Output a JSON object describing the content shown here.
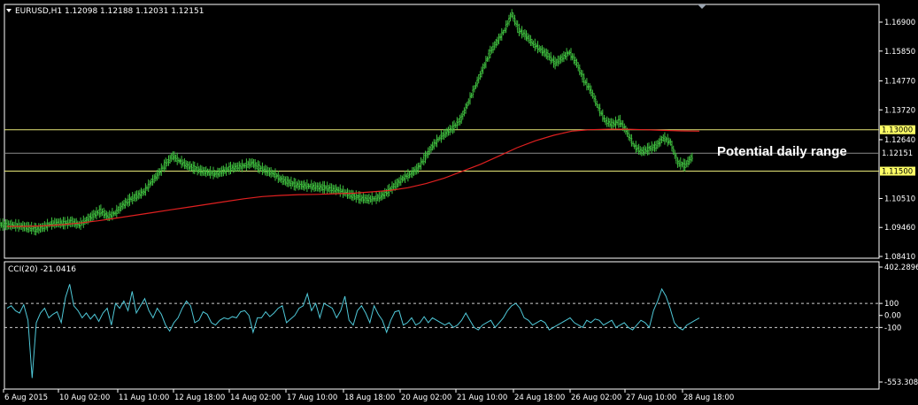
{
  "chart_header": {
    "symbol_line": "EURUSD,H1  1.12098 1.12188 1.12031 1.12151"
  },
  "indicator_header": {
    "text": "CCI(20) -21.0416"
  },
  "annotation": {
    "text": "Potential daily range"
  },
  "colors": {
    "background": "#000000",
    "candles": "#3fbf3f",
    "moving_average": "#e02020",
    "hline": "#e8e878",
    "current_price_line": "#8a8a8a",
    "cci_line": "#4fc8d8",
    "axis": "#ffffff",
    "tag_bg": "#ffff66"
  },
  "chart_data": [
    {
      "type": "line",
      "title": "EURUSD,H1",
      "ylim": [
        1.0841,
        1.174
      ],
      "price_axis_ticks": [
        "1.16900",
        "1.15850",
        "1.14770",
        "1.13720",
        "1.12640",
        "1.10510",
        "1.09460",
        "1.08410"
      ],
      "price_tags": [
        {
          "label": "1.13000",
          "value": 1.13,
          "style": "yellow"
        },
        {
          "label": "1.12151",
          "value": 1.12151,
          "style": "gray"
        },
        {
          "label": "1.11500",
          "value": 1.115,
          "style": "yellow"
        }
      ],
      "horizontal_lines": [
        1.13,
        1.115
      ],
      "current_price": 1.12151,
      "series": [
        {
          "kind": "price",
          "values": [
            1.0955,
            1.0953,
            1.095,
            1.0945,
            1.0938,
            1.0946,
            1.0958,
            1.0962,
            1.096,
            1.0966,
            1.0955,
            1.0972,
            1.099,
            1.1005,
            1.0985,
            1.0998,
            1.1025,
            1.1045,
            1.106,
            1.1075,
            1.111,
            1.114,
            1.1175,
            1.1205,
            1.1185,
            1.117,
            1.116,
            1.115,
            1.1145,
            1.114,
            1.115,
            1.116,
            1.1165,
            1.117,
            1.118,
            1.1162,
            1.115,
            1.114,
            1.112,
            1.111,
            1.11,
            1.1098,
            1.1095,
            1.1092,
            1.109,
            1.1085,
            1.108,
            1.107,
            1.106,
            1.1052,
            1.1048,
            1.105,
            1.106,
            1.108,
            1.1102,
            1.1125,
            1.114,
            1.116,
            1.12,
            1.124,
            1.127,
            1.129,
            1.131,
            1.134,
            1.14,
            1.146,
            1.152,
            1.158,
            1.162,
            1.166,
            1.172,
            1.166,
            1.164,
            1.161,
            1.159,
            1.157,
            1.154,
            1.156,
            1.158,
            1.154,
            1.148,
            1.144,
            1.138,
            1.133,
            1.132,
            1.133,
            1.129,
            1.124,
            1.122,
            1.123,
            1.124,
            1.127,
            1.1255,
            1.118,
            1.117,
            1.12,
            1.1215
          ]
        },
        {
          "kind": "moving_average",
          "values": [
            1.095,
            1.095,
            1.0952,
            1.0956,
            1.0962,
            1.097,
            1.098,
            1.099,
            1.1,
            1.101,
            1.102,
            1.103,
            1.104,
            1.105,
            1.1058,
            1.1062,
            1.1065,
            1.1066,
            1.1068,
            1.107,
            1.1075,
            1.108,
            1.109,
            1.1105,
            1.1125,
            1.115,
            1.1175,
            1.1205,
            1.1235,
            1.126,
            1.128,
            1.1295,
            1.13,
            1.1302,
            1.1302,
            1.13,
            1.1298,
            1.1296,
            1.1295
          ]
        }
      ]
    },
    {
      "type": "line",
      "title": "CCI(20)",
      "ylim": [
        -553.3084,
        402.2896
      ],
      "axis_ticks": [
        "402.2896",
        "100",
        "0.00",
        "-100",
        "-553.3084"
      ],
      "levels": [
        100,
        -100
      ],
      "series": [
        {
          "name": "CCI(20)",
          "values": [
            60,
            80,
            40,
            20,
            90,
            -40,
            -520,
            -60,
            20,
            60,
            -20,
            10,
            30,
            -60,
            150,
            260,
            80,
            40,
            -20,
            20,
            -30,
            10,
            -50,
            20,
            60,
            -80,
            100,
            60,
            120,
            40,
            200,
            20,
            80,
            140,
            40,
            -20,
            60,
            10,
            -80,
            -130,
            -60,
            -20,
            60,
            120,
            80,
            -60,
            -40,
            30,
            10,
            -60,
            -80,
            -40,
            -20,
            -30,
            -10,
            -20,
            30,
            40,
            0,
            -140,
            -20,
            -20,
            30,
            -10,
            20,
            60,
            80,
            -60,
            -30,
            0,
            60,
            80,
            180,
            40,
            100,
            -20,
            100,
            80,
            60,
            -20,
            40,
            160,
            -40,
            -80,
            40,
            80,
            20,
            -60,
            80,
            10,
            -40,
            -140,
            -40,
            30,
            40,
            -80,
            -60,
            -20,
            -80,
            -60,
            -10,
            -60,
            -20,
            -40,
            -60,
            -80,
            -60,
            -100,
            -80,
            -40,
            20,
            -40,
            -100,
            -120,
            -80,
            -60,
            -40,
            -100,
            -60,
            -20,
            40,
            80,
            100,
            60,
            -20,
            -40,
            -80,
            -60,
            -40,
            -60,
            -120,
            -100,
            -80,
            -60,
            -40,
            -20,
            -60,
            -80,
            -100,
            -40,
            -60,
            -30,
            -40,
            -80,
            -60,
            -40,
            -100,
            -80,
            -60,
            -100,
            -120,
            -80,
            -40,
            -60,
            -100,
            40,
            120,
            220,
            160,
            60,
            -60,
            -100,
            -120,
            -80,
            -60,
            -40,
            -21
          ]
        }
      ]
    }
  ],
  "time_axis": {
    "labels": [
      "6 Aug 2015",
      "10 Aug 02:00",
      "11 Aug 10:00",
      "12 Aug 18:00",
      "14 Aug 02:00",
      "17 Aug 10:00",
      "18 Aug 18:00",
      "20 Aug 02:00",
      "21 Aug 10:00",
      "24 Aug 18:00",
      "26 Aug 02:00",
      "27 Aug 10:00",
      "28 Aug 18:00"
    ]
  }
}
